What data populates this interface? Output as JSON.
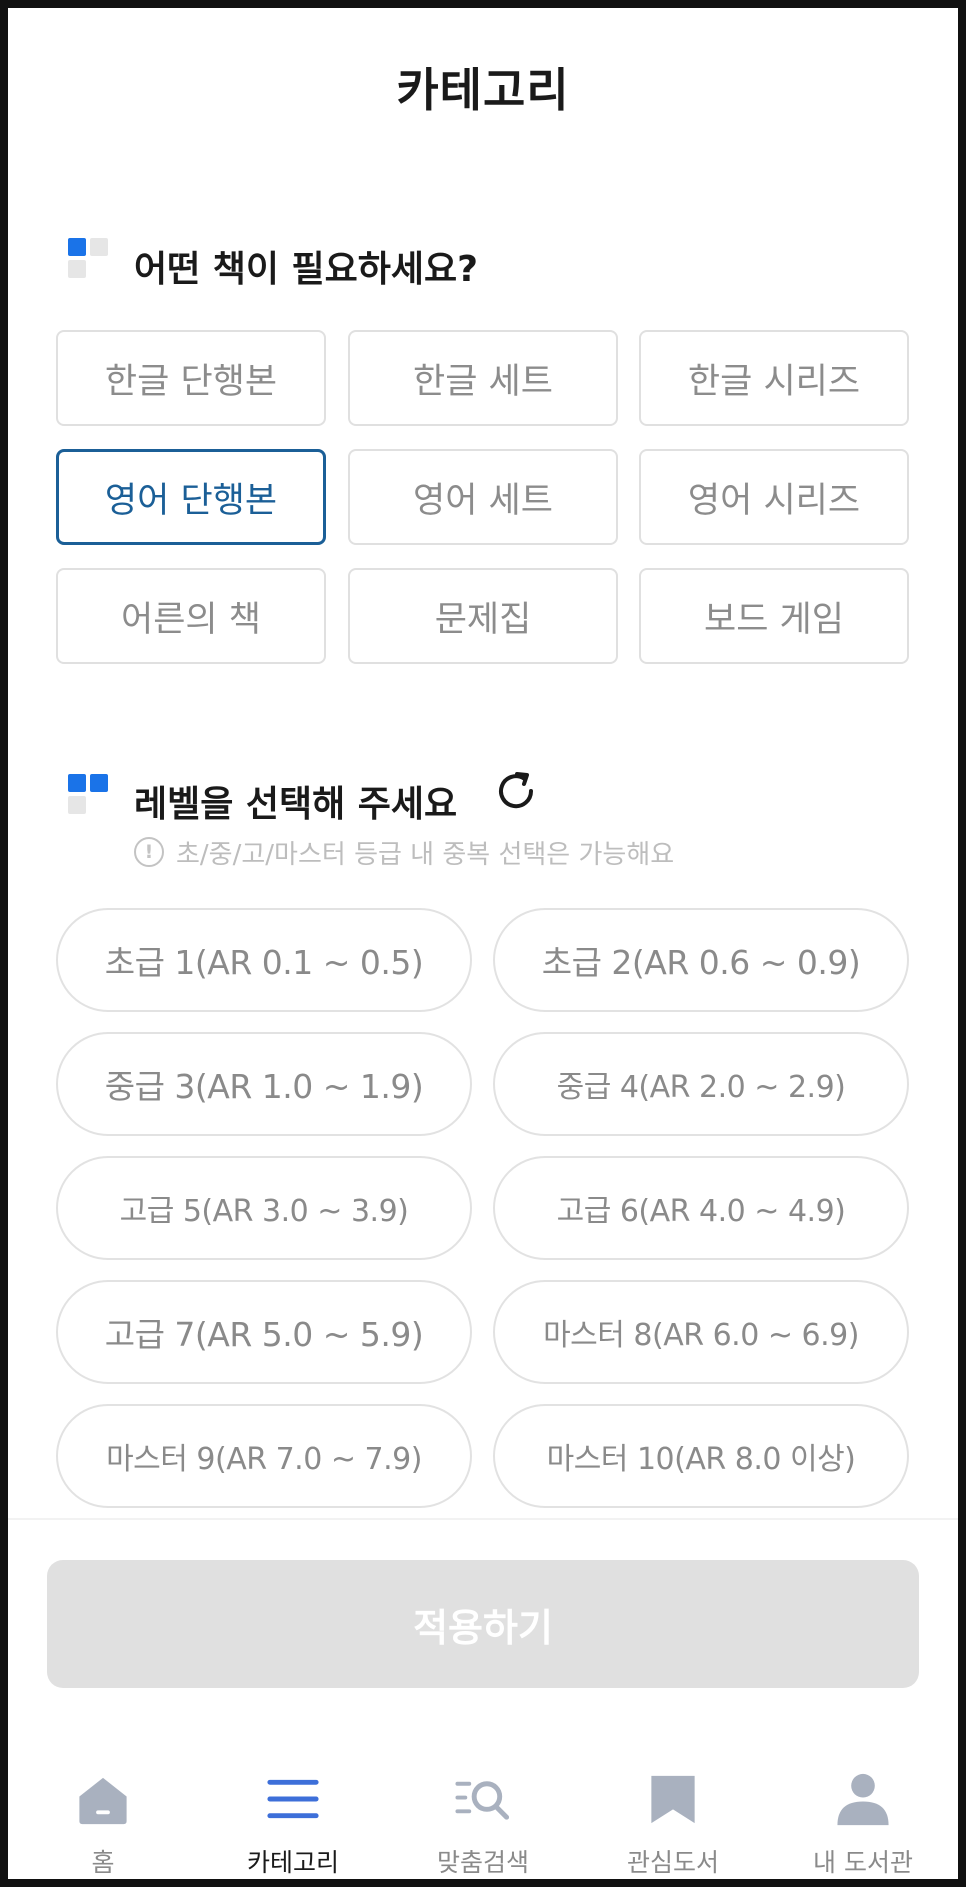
{
  "header": {
    "title": "카테고리"
  },
  "category_section": {
    "heading": "어떤 책이 필요하세요?",
    "options": [
      "한글 단행본",
      "한글 세트",
      "한글 시리즈",
      "영어 단행본",
      "영어 세트",
      "영어 시리즈",
      "어른의 책",
      "문제집",
      "보드 게임"
    ],
    "selected": "영어 단행본"
  },
  "level_section": {
    "heading": "레벨을 선택해 주세요",
    "notice": "초/중/고/마스터 등급 내 중복 선택은 가능해요",
    "options": [
      "초급 1(AR 0.1 ~ 0.5)",
      "초급 2(AR 0.6 ~ 0.9)",
      "중급 3(AR 1.0 ~ 1.9)",
      "중급 4(AR 2.0 ~ 2.9)",
      "고급 5(AR 3.0 ~ 3.9)",
      "고급 6(AR 4.0 ~ 4.9)",
      "고급 7(AR 5.0 ~ 5.9)",
      "마스터 8(AR 6.0 ~ 6.9)",
      "마스터 9(AR 7.0 ~ 7.9)",
      "마스터 10(AR 8.0 이상)"
    ]
  },
  "apply_button": {
    "label": "적용하기"
  },
  "bottom_nav": {
    "items": [
      {
        "label": "홈",
        "icon": "home-icon"
      },
      {
        "label": "카테고리",
        "icon": "menu-icon"
      },
      {
        "label": "맞춤검색",
        "icon": "search-list-icon"
      },
      {
        "label": "관심도서",
        "icon": "bookmark-icon"
      },
      {
        "label": "내 도서관",
        "icon": "person-icon"
      }
    ],
    "active": "카테고리"
  },
  "colors": {
    "accent_blue": "#1b5f97",
    "icon_blue": "#1a73e8",
    "nav_active_blue": "#3d6fd9",
    "nav_inactive": "#a9b1bf",
    "button_disabled": "#e0e0e0"
  }
}
